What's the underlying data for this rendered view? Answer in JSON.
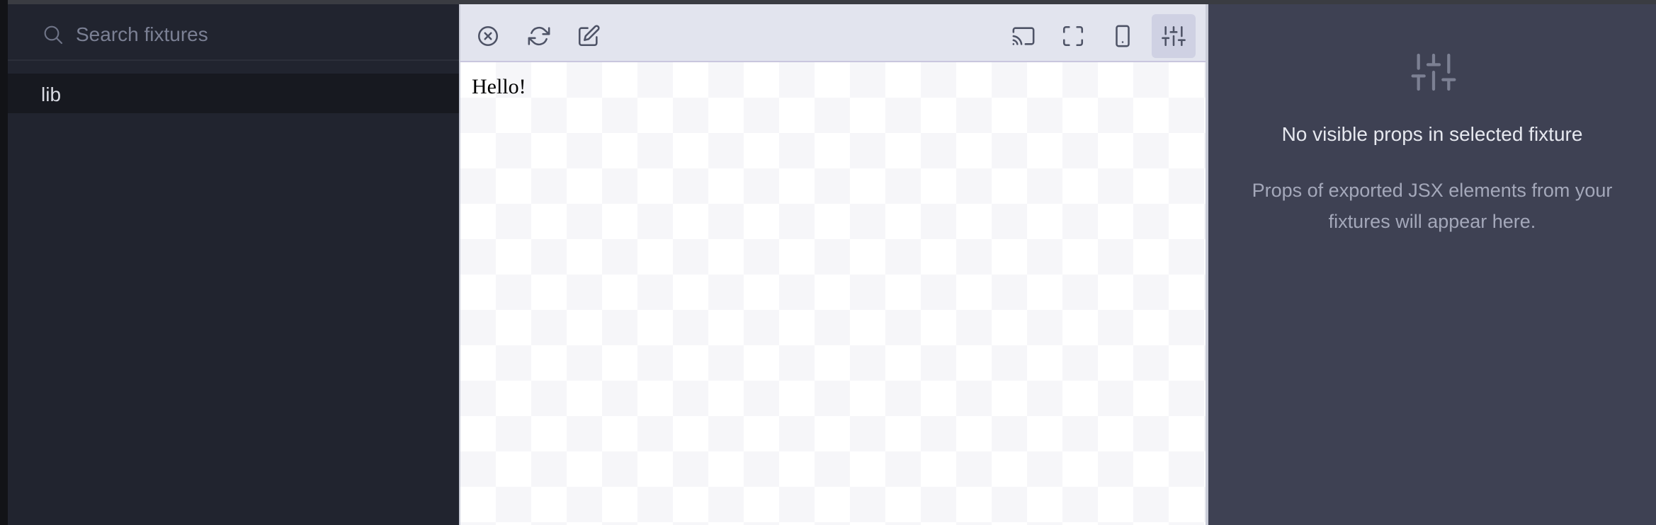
{
  "sidebar": {
    "search": {
      "placeholder": "Search fixtures",
      "value": ""
    },
    "items": [
      {
        "label": "lib"
      }
    ]
  },
  "toolbar": {
    "left_buttons": [
      "close-icon",
      "refresh-icon",
      "edit-icon"
    ],
    "right_buttons": [
      "cast-icon",
      "fullscreen-icon",
      "mobile-icon",
      "sliders-icon"
    ],
    "active_button": "sliders-icon"
  },
  "renderer": {
    "content_text": "Hello!"
  },
  "props_panel": {
    "title": "No visible props in selected fixture",
    "description": "Props of exported JSX elements from your fixtures will appear here."
  },
  "colors": {
    "sidebar_bg": "#21242f",
    "props_bg": "#3e4153",
    "toolbar_bg": "#e2e4ee"
  }
}
